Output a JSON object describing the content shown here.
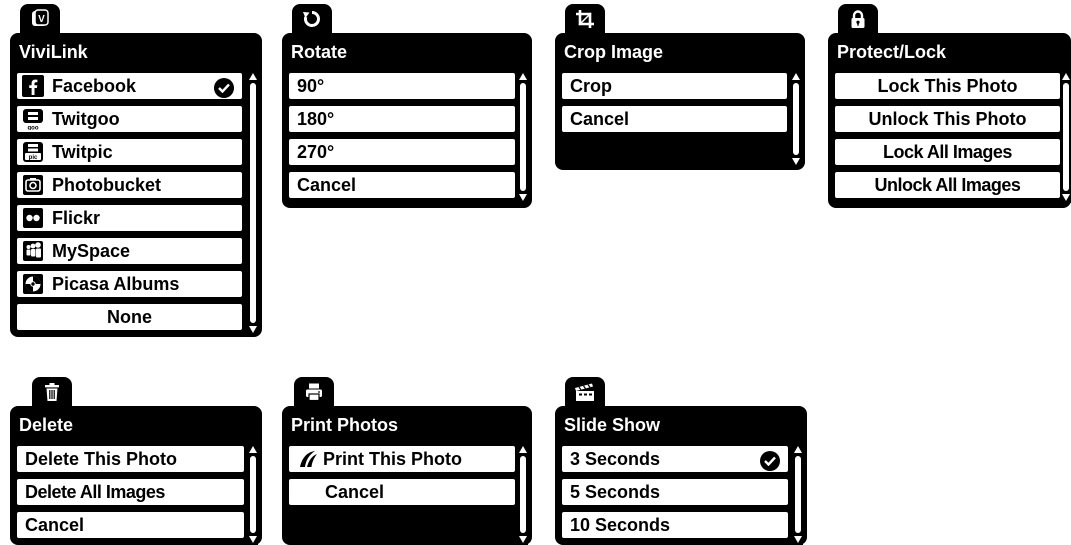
{
  "menus": {
    "vivilink": {
      "title": "ViviLink",
      "tab_icon": "vivilink-icon",
      "items": [
        {
          "label": "Facebook",
          "icon": "facebook-icon",
          "checked": true
        },
        {
          "label": "Twitgoo",
          "icon": "twitgoo-icon"
        },
        {
          "label": "Twitpic",
          "icon": "twitpic-icon"
        },
        {
          "label": "Photobucket",
          "icon": "photobucket-icon"
        },
        {
          "label": "Flickr",
          "icon": "flickr-icon"
        },
        {
          "label": "MySpace",
          "icon": "myspace-icon"
        },
        {
          "label": "Picasa Albums",
          "icon": "picasa-icon"
        },
        {
          "label": "None"
        }
      ]
    },
    "rotate": {
      "title": "Rotate",
      "tab_icon": "rotate-icon",
      "items": [
        {
          "label": "90°"
        },
        {
          "label": "180°"
        },
        {
          "label": "270°"
        },
        {
          "label": "Cancel"
        }
      ]
    },
    "crop": {
      "title": "Crop Image",
      "tab_icon": "crop-icon",
      "items": [
        {
          "label": "Crop"
        },
        {
          "label": "Cancel"
        }
      ]
    },
    "protect": {
      "title": "Protect/Lock",
      "tab_icon": "lock-icon",
      "items": [
        {
          "label": "Lock This Photo"
        },
        {
          "label": "Unlock This Photo"
        },
        {
          "label": "Lock All Images"
        },
        {
          "label": "Unlock All Images"
        }
      ]
    },
    "delete": {
      "title": "Delete",
      "tab_icon": "trash-icon",
      "items": [
        {
          "label": "Delete This Photo"
        },
        {
          "label": "Delete All Images"
        },
        {
          "label": "Cancel"
        }
      ]
    },
    "print": {
      "title": "Print Photos",
      "tab_icon": "printer-icon",
      "items": [
        {
          "label": "Print This Photo",
          "icon": "pictbridge-icon"
        },
        {
          "label": "Cancel"
        }
      ]
    },
    "slideshow": {
      "title": "Slide Show",
      "tab_icon": "clapperboard-icon",
      "items": [
        {
          "label": "3 Seconds",
          "checked": true
        },
        {
          "label": "5 Seconds"
        },
        {
          "label": "10 Seconds"
        }
      ]
    }
  }
}
